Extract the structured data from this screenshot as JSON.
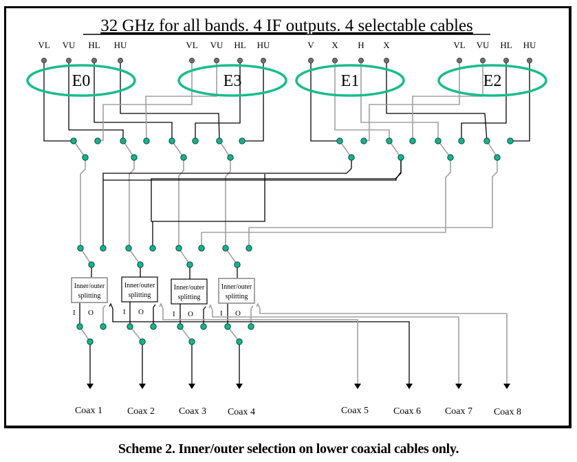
{
  "title": "32 GHz for all bands. 4 IF outputs. 4 selectable cables",
  "caption": "Scheme 2. Inner/outer selection on lower coaxial cables only.",
  "colors": {
    "ellipse": "#1abc8c",
    "node_fill": "#14b48a",
    "node_stroke": "#0a4a3a",
    "pin": "#707070",
    "wire_black": "#000000",
    "wire_gray": "#a0a0a0"
  },
  "receivers": [
    {
      "name": "E0",
      "ports": [
        "VL",
        "VU",
        "HL",
        "HU"
      ]
    },
    {
      "name": "E3",
      "ports": [
        "VL",
        "VU",
        "HL",
        "HU"
      ]
    },
    {
      "name": "E1",
      "ports": [
        "V",
        "X",
        "H",
        "X"
      ]
    },
    {
      "name": "E2",
      "ports": [
        "VL",
        "VU",
        "HL",
        "HU"
      ]
    }
  ],
  "splitters": [
    {
      "label_line1": "Inner/outer",
      "label_line2": "splitting",
      "inner_label": "I",
      "outer_label": "O"
    },
    {
      "label_line1": "Inner/outer",
      "label_line2": "splitting",
      "inner_label": "I",
      "outer_label": "O"
    },
    {
      "label_line1": "Inner/outer",
      "label_line2": "splitting",
      "inner_label": "I",
      "outer_label": "O"
    },
    {
      "label_line1": "Inner/outer",
      "label_line2": "splitting",
      "inner_label": "I",
      "outer_label": "O"
    }
  ],
  "coax_outputs": [
    "Coax 1",
    "Coax 2",
    "Coax 3",
    "Coax 4",
    "Coax 5",
    "Coax 6",
    "Coax 7",
    "Coax 8"
  ]
}
